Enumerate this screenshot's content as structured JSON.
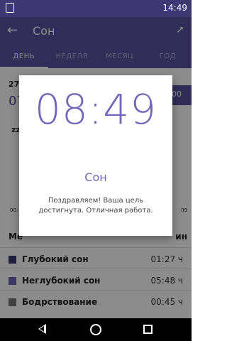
{
  "status_bar": {
    "time": "14:49"
  },
  "app_bar": {
    "title": "Сон",
    "back_icon": "arrow-left-icon",
    "share_icon": "share-icon"
  },
  "tabs": [
    {
      "label": "ДЕНЬ",
      "active": true
    },
    {
      "label": "НЕДЕЛЯ",
      "active": false
    },
    {
      "label": "МЕСЯЦ",
      "active": false
    },
    {
      "label": "ГОД",
      "active": false
    }
  ],
  "background": {
    "date_partial": "27",
    "time_partial": "07",
    "badge_partial": "00",
    "zz": "zz",
    "axis_left": "00:",
    "axis_right": "09",
    "legend_header_left": "Ме",
    "legend_header_right": "ин",
    "legend": [
      {
        "label": "Глубокий сон",
        "value": "01:27 ч",
        "color": "#3e3775"
      },
      {
        "label": "Неглубокий сон",
        "value": "05:48 ч",
        "color": "#6c64b4"
      },
      {
        "label": "Бодрствование",
        "value": "00:45 ч",
        "color": "#777777"
      }
    ]
  },
  "dialog": {
    "time": "08:49",
    "title": "Сон",
    "message": "Поздравляем! Ваша цель достигнута. Отличная работа."
  },
  "colors": {
    "primary": "#5a50a0",
    "accent": "#7068b8",
    "status_bar": "#3e3775"
  }
}
